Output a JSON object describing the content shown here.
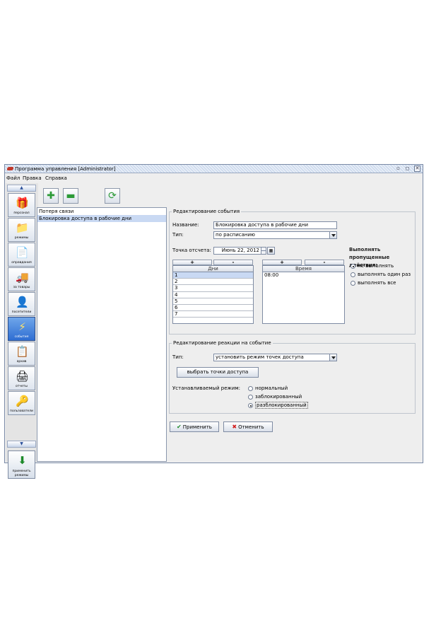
{
  "window": {
    "title": "Программа управления [Administrator]",
    "controls": [
      "minimize-icon",
      "maximize-icon",
      "close-icon"
    ]
  },
  "menu": {
    "items": [
      "Файл",
      "Правка",
      "Справка"
    ]
  },
  "nav": {
    "items": [
      {
        "label": "персонал",
        "icon": "personnel-icon"
      },
      {
        "label": "режимы",
        "icon": "modes-icon"
      },
      {
        "label": "оправдания",
        "icon": "excuses-icon"
      },
      {
        "label": "за товары",
        "icon": "goods-icon"
      },
      {
        "label": "посетители",
        "icon": "visitors-icon"
      },
      {
        "label": "события",
        "icon": "events-icon",
        "active": true
      },
      {
        "label": "архив",
        "icon": "archive-icon"
      },
      {
        "label": "отчеты",
        "icon": "reports-icon"
      },
      {
        "label": "пользователи",
        "icon": "users-icon"
      }
    ],
    "apply_modes_label": "применить режимы"
  },
  "toolbar": {
    "buttons": [
      "add-icon",
      "delete-icon",
      "refresh-icon"
    ]
  },
  "events": {
    "items": [
      "Потеря связи",
      "Блокировка доступа в рабочие дни"
    ],
    "selected_index": 1
  },
  "event_edit": {
    "title": "Редактирование события",
    "name_label": "Название:",
    "name_value": "Блокировка доступа в рабочие дни",
    "type_label": "Тип:",
    "type_value": "по расписанию",
    "start_label": "Точка отсчета:",
    "start_value": "Июнь 22, 2012",
    "days_table": {
      "add": "+",
      "remove": "-",
      "header": "Дни",
      "rows": [
        "1",
        "2",
        "3",
        "4",
        "5",
        "6",
        "7"
      ],
      "selected_index": 0
    },
    "time_table": {
      "add": "+",
      "remove": "-",
      "header": "Время",
      "rows": [
        "08:00"
      ]
    },
    "missed": {
      "title": "Выполнять пропущенные действия:",
      "options": [
        "не выполнять",
        "выполнять один раз",
        "выполнять все"
      ],
      "selected_index": 0
    }
  },
  "reaction_edit": {
    "title": "Редактирование реакции на событие",
    "type_label": "Тип:",
    "type_value": "установить режим точек доступа",
    "select_points_button": "выбрать точки доступа",
    "mode_label": "Устанавливаемый режим:",
    "modes": [
      "нормальный",
      "заблокированный",
      "разблокированный"
    ],
    "selected_index": 2
  },
  "actions": {
    "apply": "Применить",
    "cancel": "Отменить"
  },
  "colors": {
    "accent": "#2f6ed2",
    "selection": "#c9d9f3",
    "apply_icon": "#1d8a2a",
    "cancel_icon": "#d11f1f"
  }
}
